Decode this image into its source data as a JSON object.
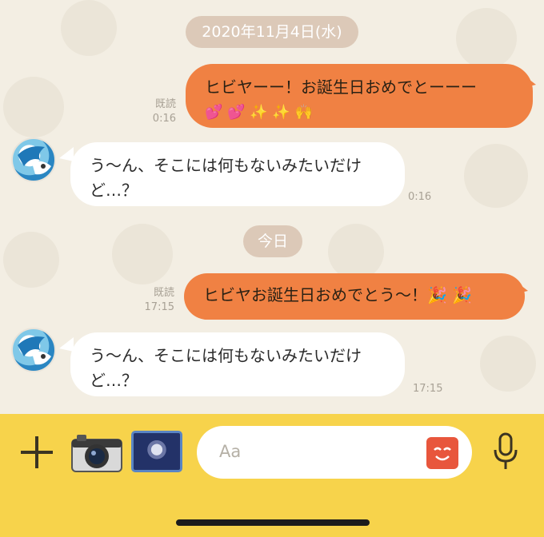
{
  "chat": {
    "date_1": "2020年11月4日(水)",
    "date_2": "今日",
    "messages": [
      {
        "side": "out",
        "line1": "ヒビヤーー！お誕生日おめでとーーー",
        "line2": "💕 💕 ✨ ✨ 🙌",
        "read": "既読",
        "time": "0:16"
      },
      {
        "side": "in",
        "line1": "う〜ん、そこには何もないみたいだけ",
        "line2": "ど…？",
        "time": "0:16"
      },
      {
        "side": "out",
        "line1": "ヒビヤお誕生日おめでとう〜！🎉 🎉",
        "read": "既読",
        "time": "17:15"
      },
      {
        "side": "in",
        "line1": "う〜ん、そこには何もないみたいだけ",
        "line2": "ど…？",
        "time": "17:15"
      }
    ]
  },
  "input_bar": {
    "placeholder": "Aa",
    "icons": [
      "plus-icon",
      "camera-icon",
      "photo-thumbnail",
      "sticker-icon",
      "microphone-icon"
    ],
    "background_color": "#f7d34b"
  },
  "colors": {
    "chat_background": "#f3eee3",
    "outgoing_bubble": "#f08143",
    "incoming_bubble": "#ffffff",
    "date_pill": "#dcc9b8"
  }
}
